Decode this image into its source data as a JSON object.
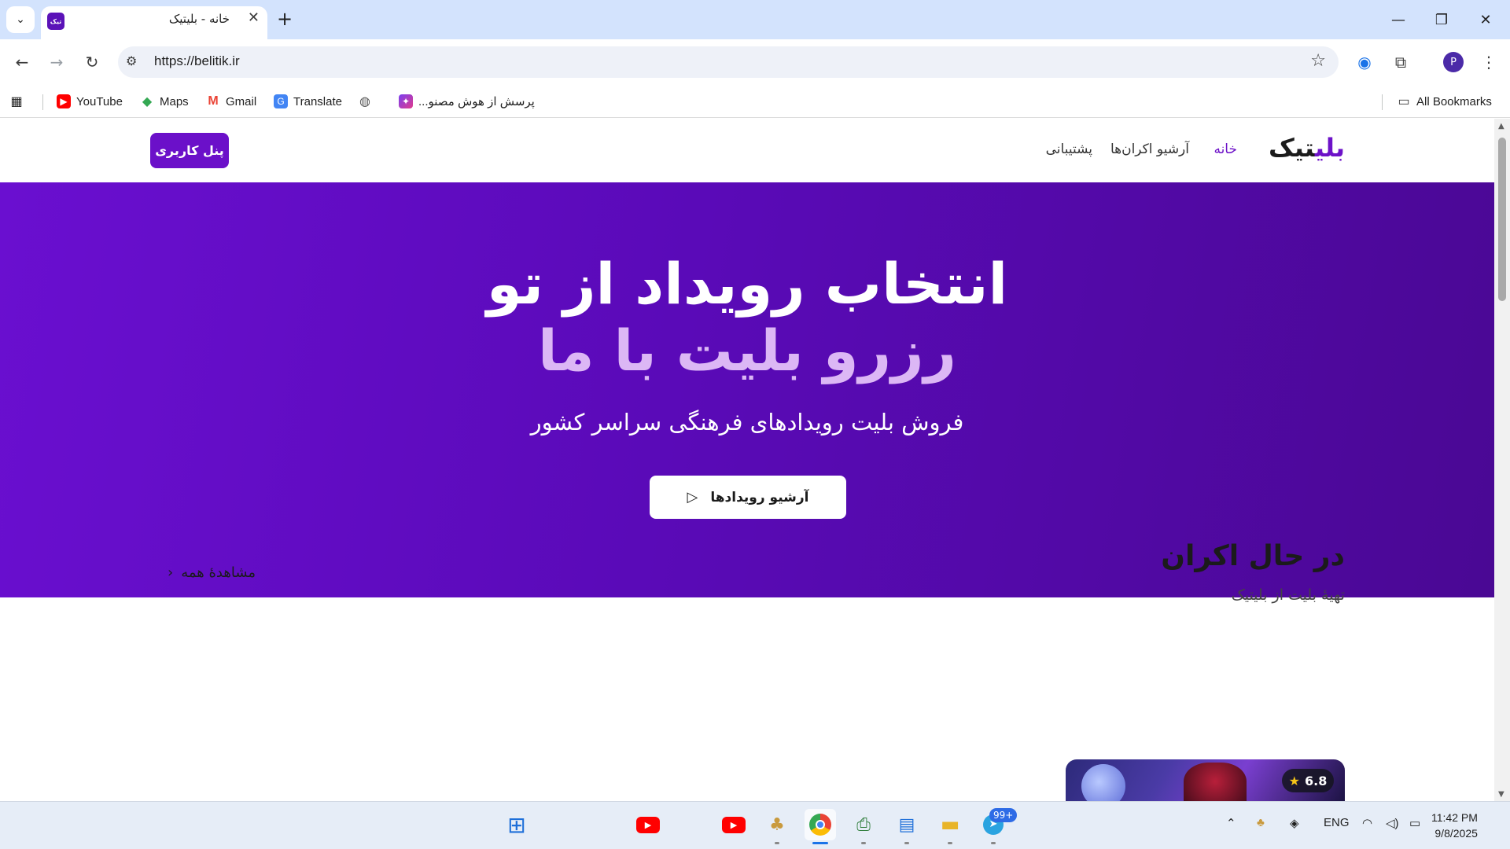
{
  "browser": {
    "tab_title": "خانه - بلیتیک",
    "tab_favicon_text": "تیک",
    "url": "https://belitik.ir",
    "bookmarks": [
      {
        "label": "YouTube",
        "icon": "youtube-icon"
      },
      {
        "label": "Maps",
        "icon": "maps-icon"
      },
      {
        "label": "Gmail",
        "icon": "gmail-icon"
      },
      {
        "label": "Translate",
        "icon": "translate-icon"
      },
      {
        "label": "",
        "icon": "globe-icon"
      },
      {
        "label": "پرسش از هوش مصنو...",
        "icon": "ai-icon"
      }
    ],
    "all_bookmarks_label": "All Bookmarks",
    "profile_initial": "P"
  },
  "site": {
    "logo_dark": "تیک",
    "logo_accent": "بلی",
    "nav": [
      {
        "label": "خانه",
        "active": true
      },
      {
        "label": "آرشیو اکران‌ها",
        "active": false
      },
      {
        "label": "پشتیبانی",
        "active": false
      }
    ],
    "panel_button": "پنل کاربری",
    "hero": {
      "title_line1": "انتخاب رویداد از تو",
      "title_line2": "رزرو بلیت با ما",
      "subtitle": "فروش بلیت رویدادهای فرهنگی سراسر کشور",
      "button_label": "آرشیو رویدادها"
    },
    "section": {
      "title": "در حال اکران",
      "subtitle": "تهیهٔ بلیت از بلیتیک",
      "see_all": "مشاهدهٔ همه"
    },
    "card": {
      "rating": "6.8"
    },
    "colors": {
      "brand": "#6b10c9",
      "hero_accent_text": "#dcb7f5"
    }
  },
  "taskbar": {
    "language": "ENG",
    "time": "11:42 PM",
    "date": "9/8/2025",
    "telegram_badge": "99+"
  }
}
